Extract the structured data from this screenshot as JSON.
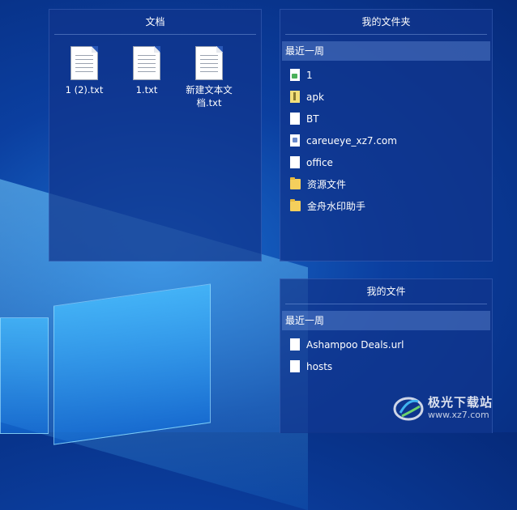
{
  "documents_panel": {
    "title": "文档",
    "files": [
      {
        "name": "1 (2).txt",
        "icon": "text-file-icon"
      },
      {
        "name": "1.txt",
        "icon": "text-file-icon"
      },
      {
        "name": "新建文本文档.txt",
        "icon": "text-file-icon"
      }
    ]
  },
  "my_folders_panel": {
    "title": "我的文件夹",
    "section": "最近一周",
    "items": [
      {
        "name": "1",
        "icon": "image-file-icon"
      },
      {
        "name": "apk",
        "icon": "archive-file-icon"
      },
      {
        "name": "BT",
        "icon": "blank-file-icon"
      },
      {
        "name": "careueye_xz7.com",
        "icon": "document-file-icon"
      },
      {
        "name": "office",
        "icon": "blank-file-icon"
      },
      {
        "name": "资源文件",
        "icon": "folder-icon"
      },
      {
        "name": "金舟水印助手",
        "icon": "folder-icon"
      }
    ]
  },
  "my_files_panel": {
    "title": "我的文件",
    "section": "最近一周",
    "items": [
      {
        "name": "Ashampoo Deals.url",
        "icon": "blank-file-icon"
      },
      {
        "name": "hosts",
        "icon": "blank-file-icon"
      }
    ]
  },
  "watermark": {
    "text": "极光下载站",
    "url": "www.xz7.com"
  },
  "colors": {
    "desktop_bg": "#0b3fa0",
    "panel_bg": "#10348c",
    "section_header_bg": "#7aa0e6",
    "folder_yellow": "#f4cf5c"
  }
}
